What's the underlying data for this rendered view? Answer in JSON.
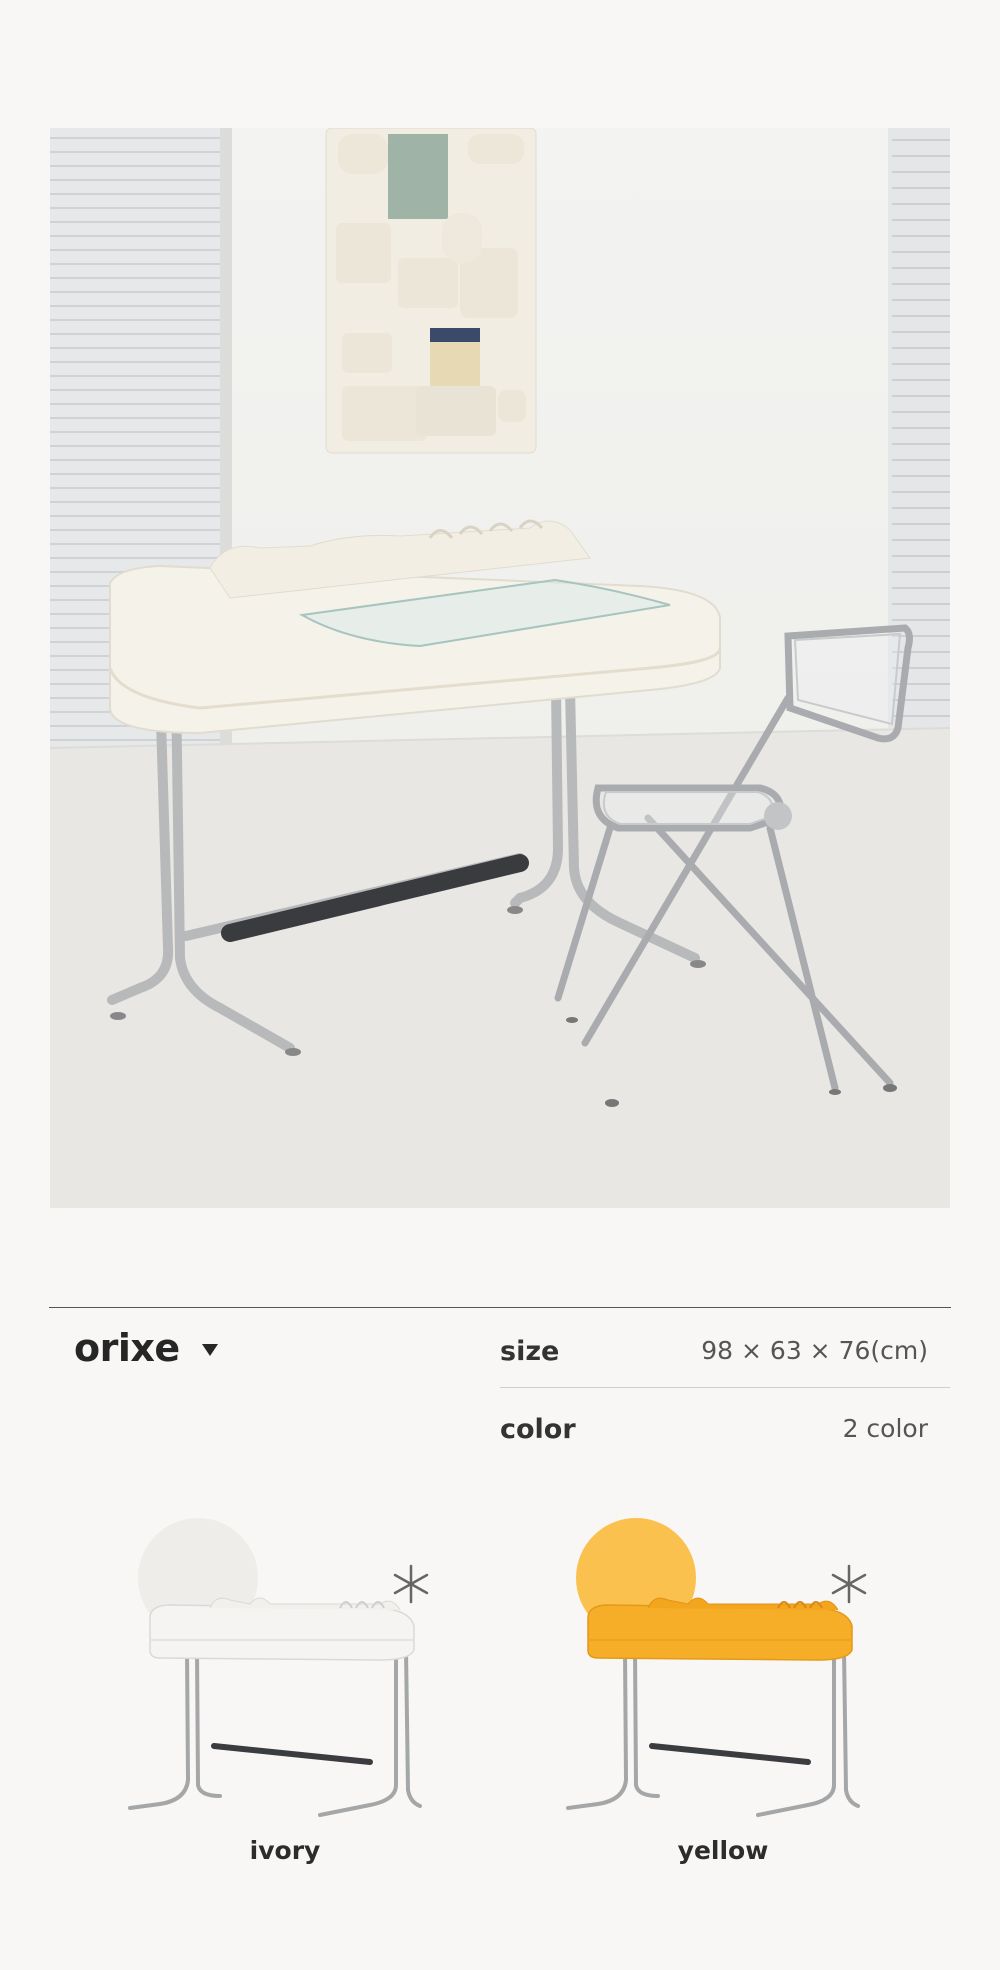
{
  "product": {
    "name": "orixe"
  },
  "specs": {
    "size_label": "size",
    "size_value": "98 × 63 × 76(cm)",
    "color_label": "color",
    "color_value": "2 color"
  },
  "colors": [
    {
      "label": "ivory",
      "hex": "#f1efe9"
    },
    {
      "label": "yellow",
      "hex": "#f6b632"
    }
  ],
  "icons": {
    "dropdown": "triangle-down-icon",
    "sparkle": "asterisk-icon"
  }
}
